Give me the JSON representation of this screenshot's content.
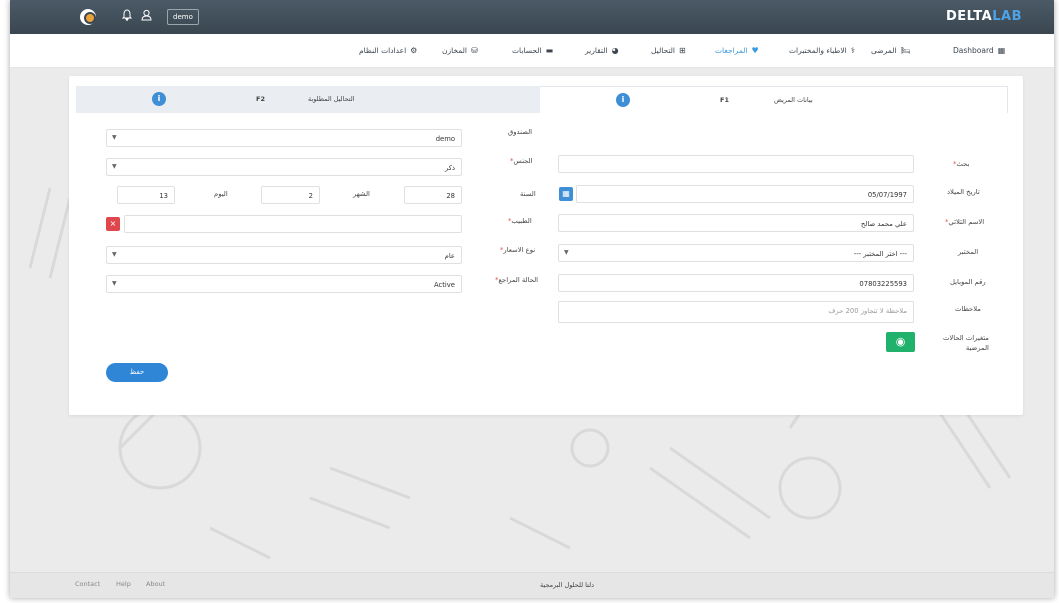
{
  "topbar": {
    "brand_part1": "DELTA",
    "brand_part2": "LAB",
    "user_button": "demo"
  },
  "nav": {
    "dashboard": "Dashboard",
    "patients": "المرضى",
    "doctors_labs": "الاطباء والمختبرات",
    "visits": "المراجعات",
    "tests": "التحاليل",
    "reports": "التقارير",
    "accounts": "الحسابات",
    "storage": "المخازن",
    "settings": "اعدادات النظام"
  },
  "tabs": {
    "f1_label": "بيانات المريض",
    "f1_key": "F1",
    "f2_label": "التحاليل المطلوبة",
    "f2_key": "F2"
  },
  "form_right": {
    "search_label": "بحث",
    "birthdate_label": "تاريخ الميلاد",
    "birthdate_value": "05/07/1997",
    "fullname_label": "الاسم الثلاثي",
    "fullname_value": "علي محمد صالح",
    "lab_label": "المختبر",
    "lab_value": "--- اختر المختبر ---",
    "mobile_label": "رقم الموبايل",
    "mobile_value": "07803225593",
    "notes_label": "ملاحظات",
    "notes_placeholder": "ملاحظة لا تتجاوز 200 حرف",
    "conditions_label_line1": "متغيرات الحالات",
    "conditions_label_line2": "المرضية"
  },
  "form_left": {
    "fund_label": "الصندوق",
    "fund_value": "demo",
    "gender_label": "الجنس",
    "gender_value": "ذكر",
    "year_label": "السنة",
    "year_value": "28",
    "month_label": "الشهر",
    "month_value": "2",
    "day_label": "اليوم",
    "day_value": "13",
    "doctor_label": "الطبيب",
    "price_type_label": "نوع الاسعار",
    "price_type_value": "عام",
    "visit_status_label": "الحالة المراجع",
    "visit_status_value": "Active",
    "save_label": "حفظ"
  },
  "footer": {
    "contact": "Contact",
    "help": "Help",
    "about": "About",
    "company": "دلتا للحلول البرمجية"
  },
  "colors": {
    "topbar": "#3a4751",
    "accent": "#3b9ae1",
    "save": "#2f86d6",
    "danger": "#e0474c",
    "success": "#20b26d"
  }
}
